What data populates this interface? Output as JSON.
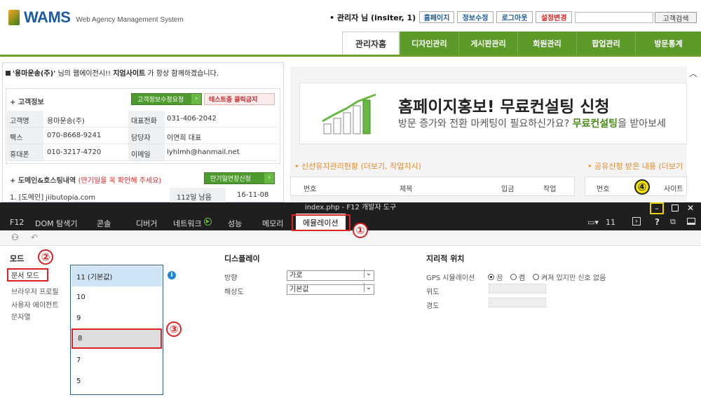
{
  "header": {
    "brand": "WAMS",
    "brand_sub": "Web Agency Management System",
    "admin_text": "• 관리자 님 (insiter, 1)",
    "buttons": [
      "홈페이지",
      "정보수정",
      "로그아웃",
      "설정변경"
    ],
    "search_button": "고객검색"
  },
  "nav": {
    "tabs": [
      "관리자홈",
      "디자인관리",
      "게시판관리",
      "회원관리",
      "팝업관리",
      "방문통계"
    ]
  },
  "welcome": {
    "prefix": "'용마운송(주)'",
    "mid": " 님의 웹에이전시!! ",
    "strong": "지엄사이트",
    "suffix": " 가 항상 함께하겠습니다."
  },
  "customer": {
    "title": "+ 고객정보",
    "edit_button": "고객정보수정요청",
    "test_button": "테스트중 클릭금지",
    "rows": [
      {
        "l1": "고객명",
        "v1": "용마운송(주)",
        "l2": "대표전화",
        "v2": "031-406-2042"
      },
      {
        "l1": "팩스",
        "v1": "070-8668-9241",
        "l2": "담당자",
        "v2": "이연희 대표"
      },
      {
        "l1": "휴대폰",
        "v1": "010-3217-4720",
        "l2": "이메일",
        "v2": "lyhlmh@hanmail.net"
      }
    ]
  },
  "domain": {
    "title": "+ 도메인&호스팅내역",
    "warn": "(만기일을 꼭 확인해 주세요)",
    "extend_button": "만기일연장신청",
    "row": {
      "name": "1. [도메인] jiibutopia.com",
      "remain": "112일 남음",
      "date": "16-11-08"
    }
  },
  "banner": {
    "title": "홈페이지홍보! 무료컨설팅 신청",
    "sub_a": "방문 증가와 전환 마케팅이 필요하신가요? ",
    "sub_b": "무료컨설팅",
    "sub_c": "을 받아보세"
  },
  "right_sections": {
    "sec1": "• 신선유지관리현황 (더보기, 작업지시)",
    "sec2": "• 공유신청 받은 내용 (더보기",
    "table1_headers": [
      "번호",
      "제목",
      "입금",
      "작업"
    ],
    "table2_headers": [
      "번호",
      "사이트"
    ]
  },
  "devtools": {
    "title": "index.php - F12 개발자 도구",
    "tabs": [
      "F12",
      "DOM 탐색기",
      "콘솔",
      "디버거",
      "네트워크",
      "성능",
      "메모리",
      "에뮬레이션"
    ],
    "zoom_count": "11",
    "mode_title": "모드",
    "left_items": [
      "문서 모드",
      "브라우저 프로필",
      "사용자 에이전트",
      "문자열"
    ],
    "doc_modes": [
      "11 (기본값)",
      "10",
      "9",
      "8",
      "7",
      "5"
    ],
    "display_title": "디스플레이",
    "orientation_label": "방향",
    "orientation_value": "가로",
    "resolution_label": "해상도",
    "resolution_value": "기본값",
    "geo_title": "지리적 위치",
    "gps_label": "GPS 시뮬레이션",
    "gps_options": [
      "끔",
      "켬",
      "켜져 있지만 신호 없음"
    ],
    "lat_label": "위도",
    "lng_label": "경도"
  },
  "annotations": [
    "①",
    "②",
    "③",
    "④"
  ]
}
